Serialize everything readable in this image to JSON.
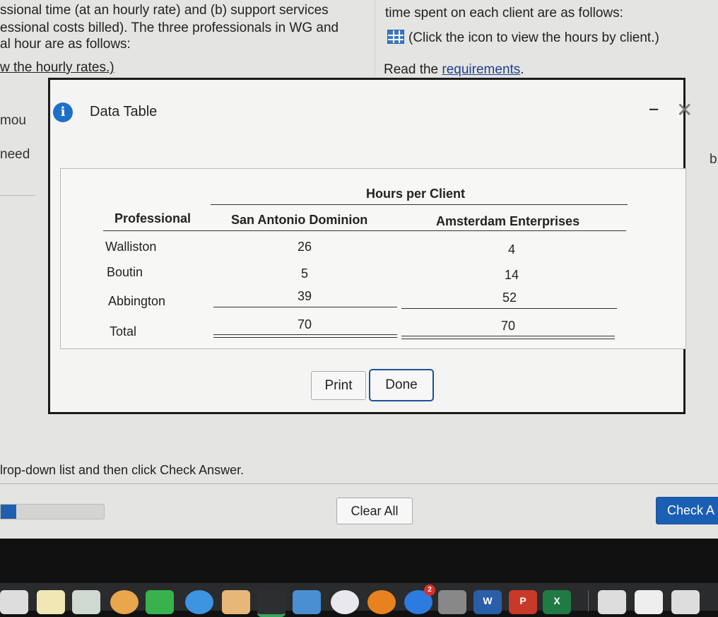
{
  "question": {
    "left_lines": [
      "ssional time (at an hourly rate) and (b) support services",
      "essional costs billed). The three professionals in WG and",
      "al hour are as follows:"
    ],
    "left_link_line": "w the hourly rates.)",
    "right_line1": "time spent on each client are as follows:",
    "right_icon_text": "(Click the icon to view the hours by client.)",
    "read_prefix": "Read the ",
    "read_link": "requirements",
    "read_suffix": ".",
    "cut_mou": "mou",
    "cut_need": "need",
    "cut_right": "b"
  },
  "modal": {
    "info_icon": "i",
    "title": "Data Table",
    "minimize": "‒",
    "close": "✕",
    "table": {
      "group_header": "Hours per Client",
      "columns": [
        "Professional",
        "San Antonio Dominion",
        "Amsterdam Enterprises"
      ],
      "rows": [
        {
          "name": "Walliston",
          "san_antonio": "26",
          "amsterdam": "4"
        },
        {
          "name": "Boutin",
          "san_antonio": "5",
          "amsterdam": "14"
        },
        {
          "name": "Abbington",
          "san_antonio": "39",
          "amsterdam": "52"
        }
      ],
      "total": {
        "name": "Total",
        "san_antonio": "70",
        "amsterdam": "70"
      }
    },
    "print_label": "Print",
    "done_label": "Done"
  },
  "footer": {
    "instruction": "lrop-down list and then click Check Answer.",
    "progress_percent": 15,
    "clear_all": "Clear All",
    "check_answer": "Check A"
  },
  "dock": {
    "app_store_badge": "2",
    "word_letter": "W",
    "powerpoint_letter": "P",
    "excel_letter": "X"
  },
  "colors": {
    "accent": "#1e6fc7",
    "check_button": "#1a5fb4"
  }
}
